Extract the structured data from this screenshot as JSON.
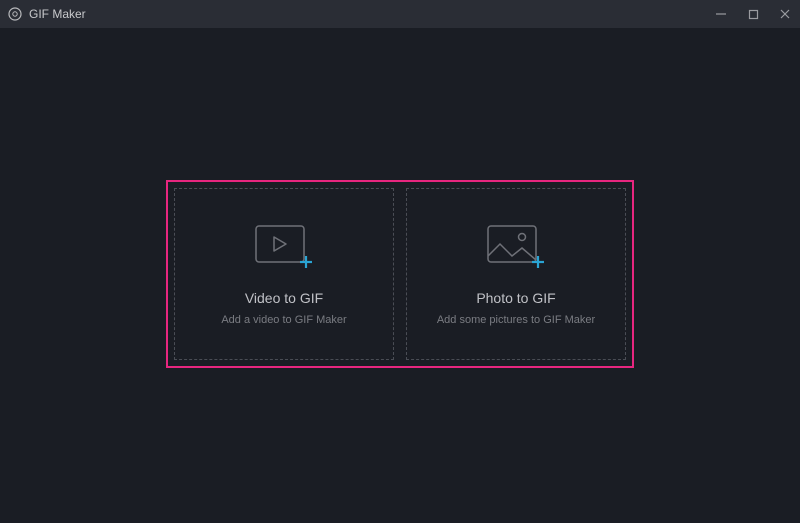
{
  "titlebar": {
    "app_title": "GIF Maker"
  },
  "main": {
    "options": [
      {
        "title": "Video to GIF",
        "subtitle": "Add a video to GIF Maker"
      },
      {
        "title": "Photo to GIF",
        "subtitle": "Add some pictures to GIF Maker"
      }
    ]
  },
  "colors": {
    "accent": "#e7267f",
    "plus": "#2aa4d4"
  }
}
